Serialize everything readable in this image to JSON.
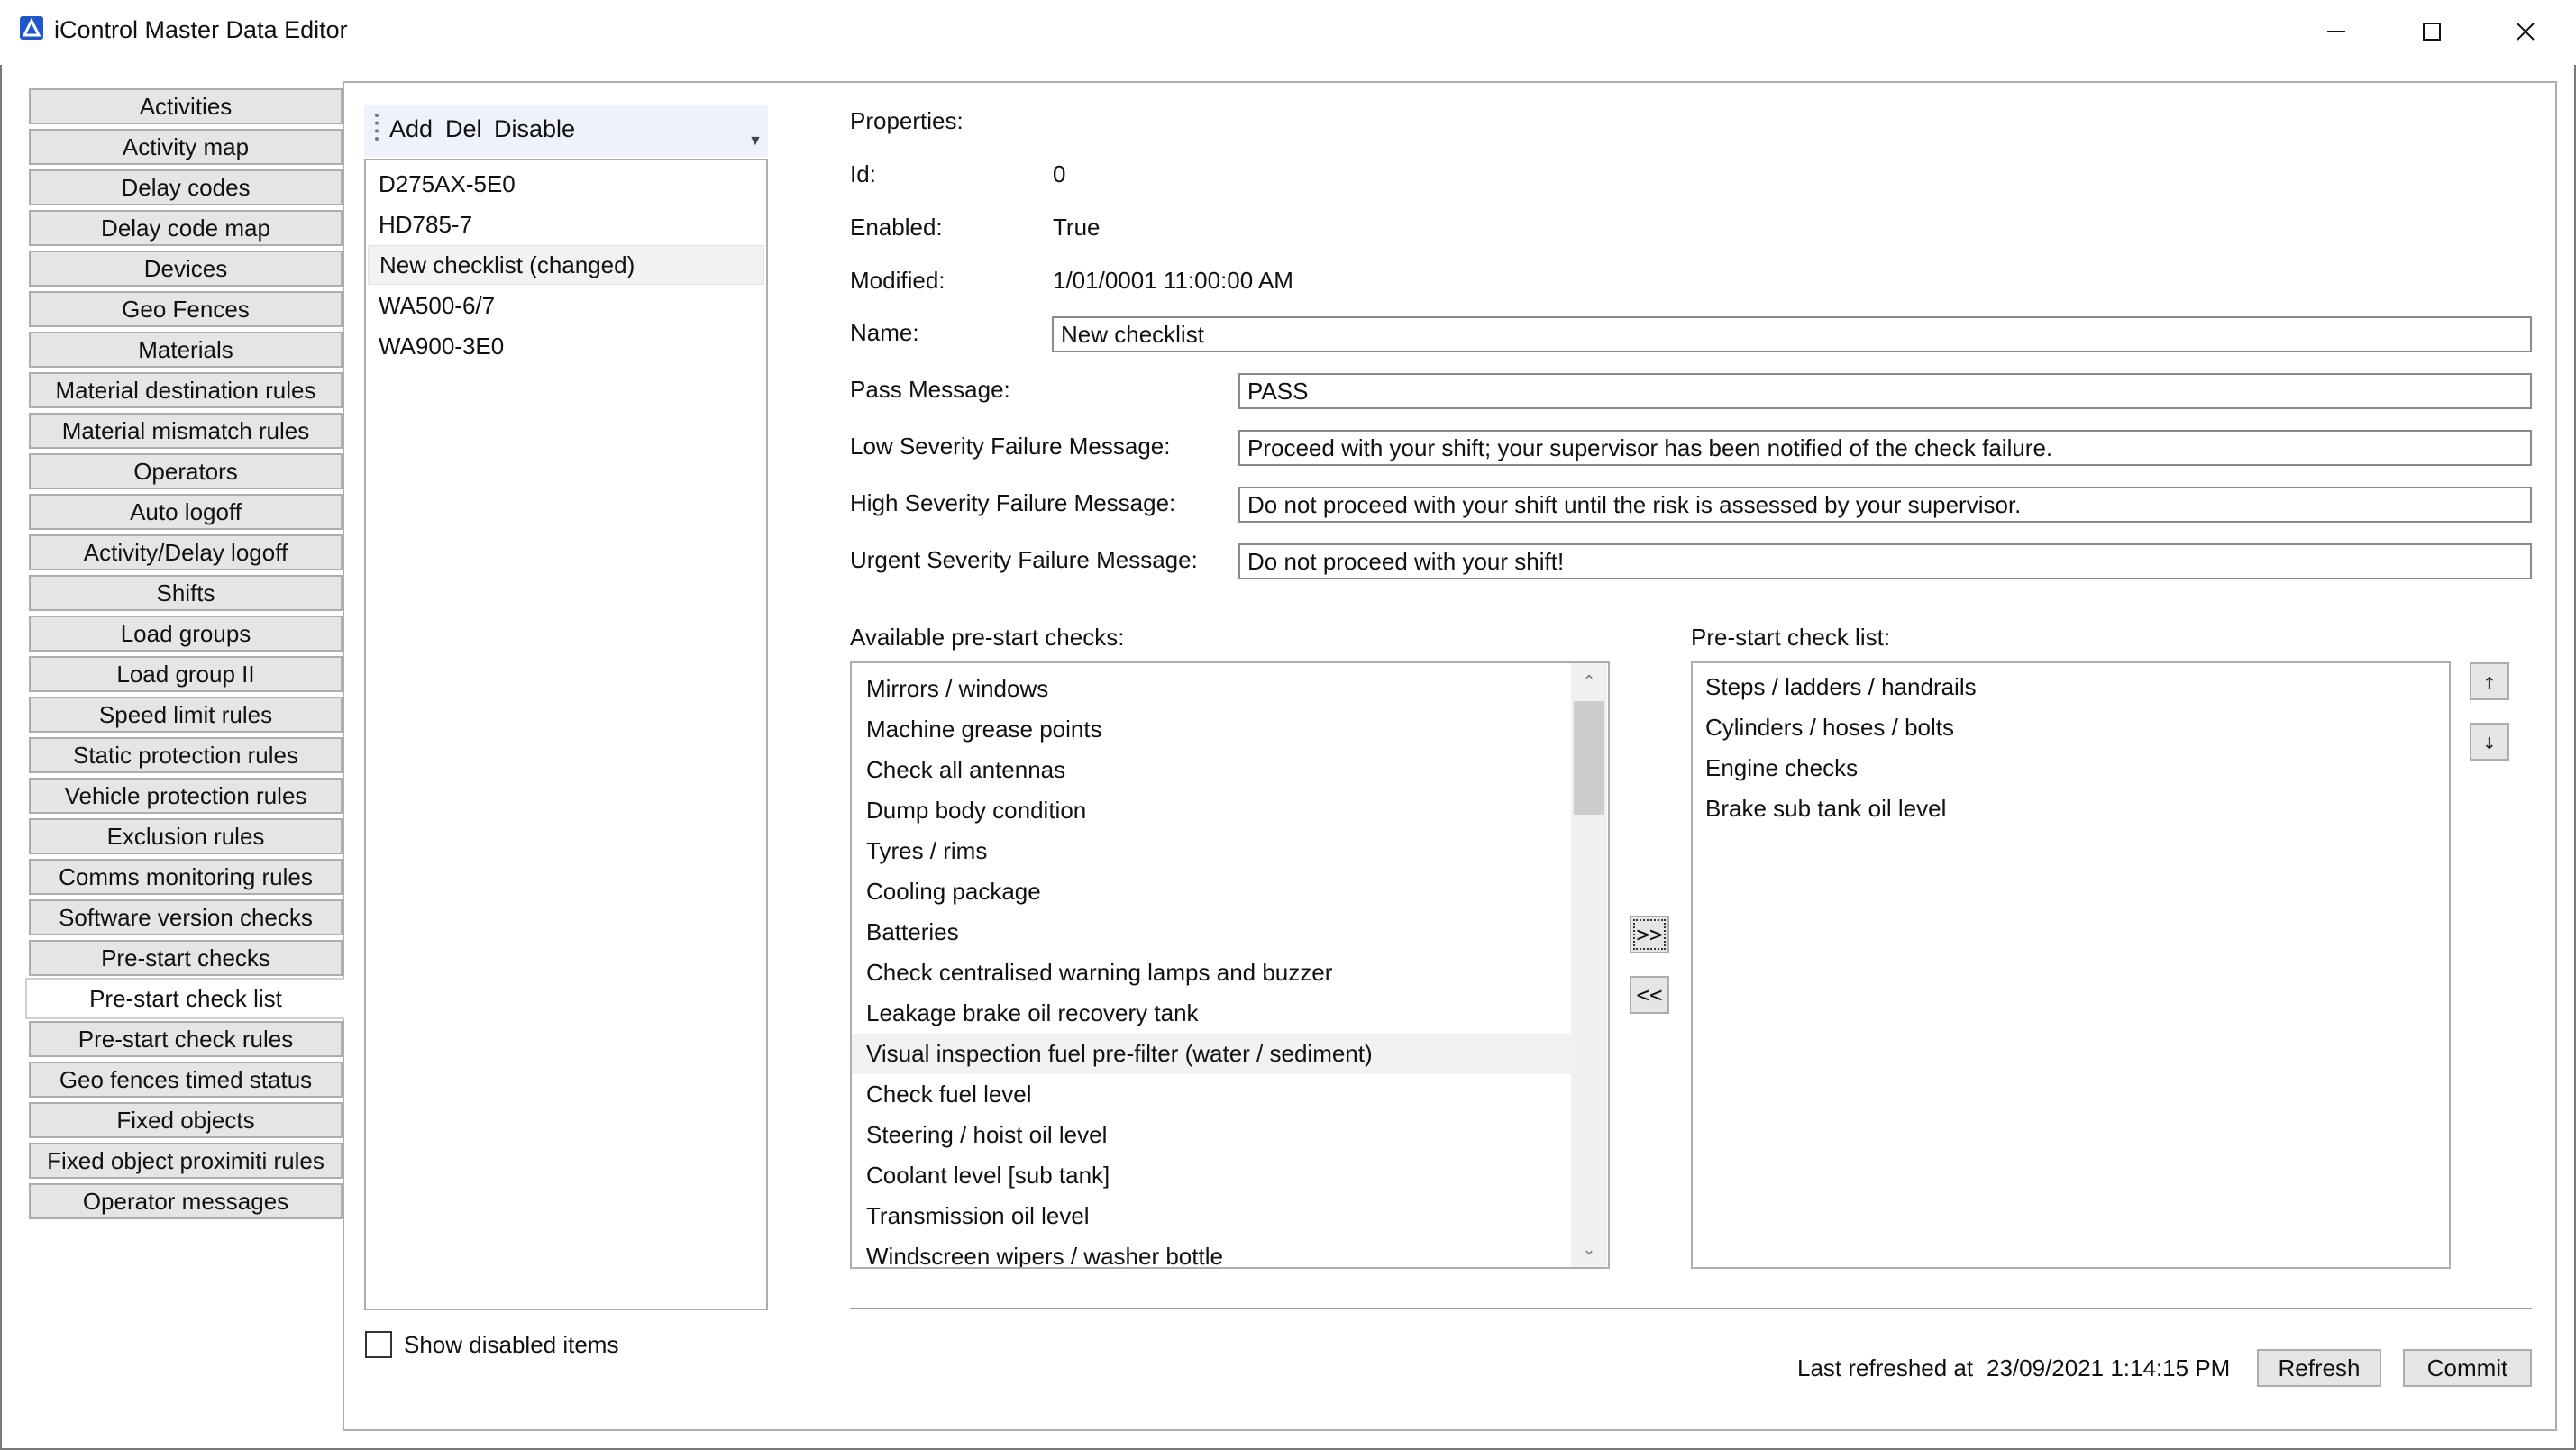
{
  "window": {
    "title": "iControl Master Data Editor",
    "controls": [
      "minimize-icon",
      "maximize-icon",
      "close-icon"
    ]
  },
  "nav": {
    "active": "Pre-start check list",
    "items": [
      "Activities",
      "Activity map",
      "Delay codes",
      "Delay code map",
      "Devices",
      "Geo Fences",
      "Materials",
      "Material destination rules",
      "Material mismatch rules",
      "Operators",
      "Auto logoff",
      "Activity/Delay logoff",
      "Shifts",
      "Load groups",
      "Load group II",
      "Speed limit rules",
      "Static protection rules",
      "Vehicle protection rules",
      "Exclusion rules",
      "Comms monitoring rules",
      "Software version checks",
      "Pre-start checks",
      "Pre-start check list",
      "Pre-start check rules",
      "Geo fences timed status",
      "Fixed objects",
      "Fixed object proximiti rules",
      "Operator messages"
    ]
  },
  "toolbar": {
    "add": "Add",
    "del": "Del",
    "disable": "Disable"
  },
  "checklists": {
    "items": [
      "D275AX-5E0",
      "HD785-7",
      "New checklist (changed)",
      "WA500-6/7",
      "WA900-3E0"
    ],
    "selected": "New checklist (changed)"
  },
  "show_disabled": {
    "label": "Show disabled items",
    "checked": false
  },
  "properties": {
    "heading": "Properties:",
    "id_label": "Id:",
    "id_value": "0",
    "enabled_label": "Enabled:",
    "enabled_value": "True",
    "modified_label": "Modified:",
    "modified_value": "1/01/0001 11:00:00 AM",
    "name_label": "Name:",
    "name_value": "New checklist",
    "pass_label": "Pass Message:",
    "pass_value": "PASS",
    "low_label": "Low Severity Failure Message:",
    "low_value": "Proceed with your shift; your supervisor has been notified of the check failure.",
    "high_label": "High Severity Failure Message:",
    "high_value": "Do not proceed with your shift until the risk is assessed by your supervisor.",
    "urgent_label": "Urgent Severity Failure Message:",
    "urgent_value": "Do not proceed with your shift!"
  },
  "available": {
    "label": "Available pre-start checks:",
    "selected": "Visual inspection fuel pre-filter (water / sediment)",
    "items": [
      "Mirrors / windows",
      "Machine grease points",
      "Check all antennas",
      "Dump body condition",
      "Tyres / rims",
      "Cooling package",
      "Batteries",
      "Check centralised warning lamps and buzzer",
      "Leakage brake oil recovery tank",
      "Visual inspection fuel pre-filter (water / sediment)",
      "Check fuel level",
      "Steering / hoist oil level",
      "Coolant level [sub tank]",
      "Transmission oil level",
      "Windscreen wipers / washer bottle"
    ]
  },
  "checklist": {
    "label": "Pre-start check list:",
    "items": [
      "Steps / ladders / handrails",
      "Cylinders / hoses / bolts",
      "Engine checks",
      "Brake sub tank oil level"
    ]
  },
  "move": {
    "add": ">>",
    "remove": "<<",
    "up": "↑",
    "down": "↓"
  },
  "footer": {
    "last_refreshed_label": "Last refreshed at",
    "last_refreshed_value": "23/09/2021 1:14:15 PM",
    "refresh": "Refresh",
    "commit": "Commit"
  }
}
